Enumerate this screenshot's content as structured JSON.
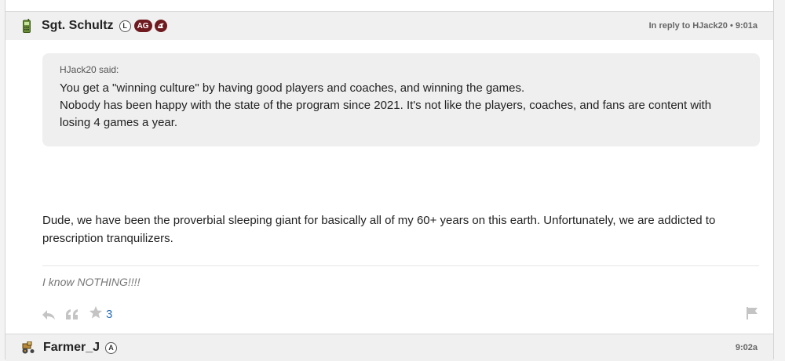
{
  "post": {
    "username": "Sgt. Schultz",
    "badge_l": "L",
    "badge_ag": "AG",
    "meta": "In reply to HJack20 • 9:01a",
    "quote": {
      "attribution": "HJack20 said:",
      "lines": [
        "You get a \"winning culture\" by having good players and coaches, and winning the games.",
        "Nobody has been happy with the state of the program since 2021. It's not like the players, coaches, and fans are content with losing 4 games a year."
      ]
    },
    "body": "Dude, we have been the proverbial sleeping giant for basically all of my 60+ years on this earth. Unfortunately, we are addicted to prescription tranquilizers.",
    "signature": "I know NOTHING!!!!",
    "star_count": "3"
  },
  "next_post": {
    "username": "Farmer_J",
    "badge_a": "A",
    "time": "9:02a"
  },
  "icons": [
    "phone-avatar-icon",
    "reply-icon",
    "quote-icon",
    "star-icon",
    "flag-icon",
    "tractor-avatar-icon"
  ],
  "colors": {
    "accent_maroon": "#6e1a1f",
    "link_blue": "#2a6fb5"
  }
}
